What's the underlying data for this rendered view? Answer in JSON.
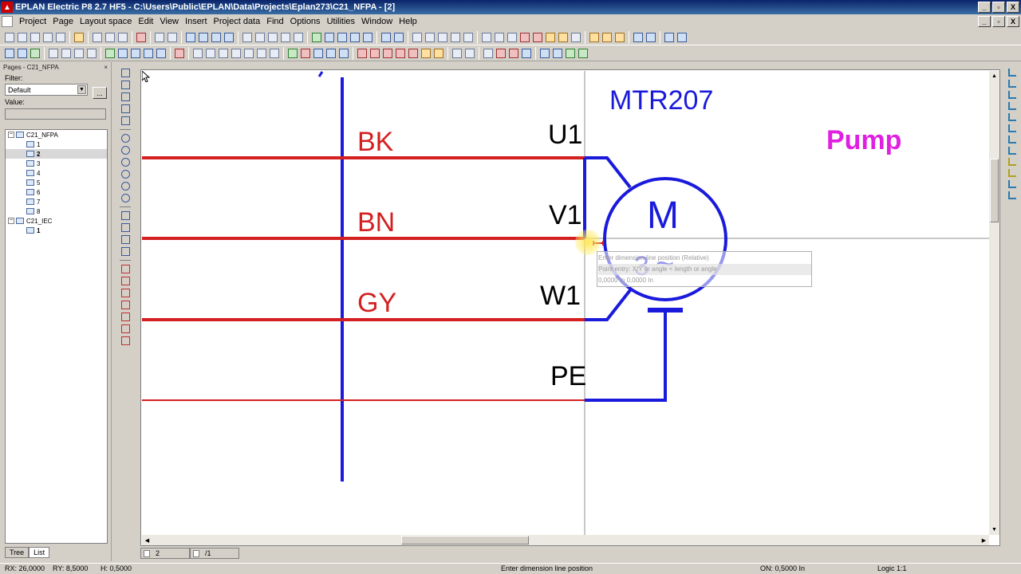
{
  "window": {
    "title": "EPLAN Electric P8 2.7 HF5 - C:\\Users\\Public\\EPLAN\\Data\\Projects\\Eplan273\\C21_NFPA - [2]",
    "minimize": "_",
    "maximize": "▫",
    "close": "X"
  },
  "menu": [
    "Project",
    "Page",
    "Layout space",
    "Edit",
    "View",
    "Insert",
    "Project data",
    "Find",
    "Options",
    "Utilities",
    "Window",
    "Help"
  ],
  "left_panel": {
    "header": "Pages - C21_NFPA",
    "close": "×",
    "filter_label": "Filter:",
    "filter_value": "Default",
    "filter_more": "...",
    "value_label": "Value:",
    "tree": [
      {
        "label": "C21_NFPA",
        "level": 0,
        "toggle": "−"
      },
      {
        "label": "1",
        "level": 1
      },
      {
        "label": "2",
        "level": 1,
        "selected": true
      },
      {
        "label": "3",
        "level": 1
      },
      {
        "label": "4",
        "level": 1
      },
      {
        "label": "5",
        "level": 1
      },
      {
        "label": "6",
        "level": 1
      },
      {
        "label": "7",
        "level": 1
      },
      {
        "label": "8",
        "level": 1
      },
      {
        "label": "C21_IEC",
        "level": 0,
        "toggle": "−"
      },
      {
        "label": "1",
        "level": 1,
        "bold": true
      }
    ],
    "tabs": [
      "Tree",
      "List"
    ]
  },
  "schematic": {
    "device_tag": "MTR207",
    "function_text": "Pump",
    "motor_letter": "M",
    "motor_phases": "3",
    "motor_ac": "~",
    "wire_colors": [
      "BK",
      "BN",
      "GY"
    ],
    "terminals": [
      "U1",
      "V1",
      "W1",
      "PE"
    ],
    "colors": {
      "wire": "#d42020",
      "symbol": "#1a1adc",
      "function_text": "#e020e0",
      "terminal_text": "#000000"
    }
  },
  "tooltip": {
    "line1": "Enter dimension line position (Relative)",
    "line2": "Point entry: X/Y or angle < length or angle",
    "line3": "0,0000 In   0,0000 In"
  },
  "page_tabs": [
    "2",
    "/1"
  ],
  "status": {
    "rx": "RX: 26,0000",
    "ry": "RY: 8,5000",
    "h": "H: 0,5000",
    "prompt": "Enter dimension line position",
    "on": "ON: 0,5000 In",
    "logic": "Logic 1:1"
  }
}
